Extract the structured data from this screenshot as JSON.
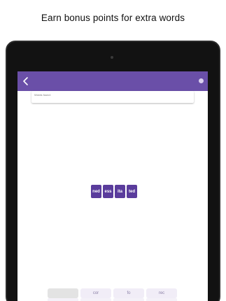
{
  "caption": "Earn bonus points for extra words",
  "colors": {
    "app_bar": "#6a4fa8",
    "tile": "#5a3c9c",
    "option": "#f1edf7",
    "option_used": "#e3e3e3"
  },
  "header": {
    "back_icon": "arrow-left-icon",
    "help_icon": "question-icon"
  },
  "words_found": {
    "label": "Words found:"
  },
  "tiles": [
    "ned",
    "ess",
    "ita",
    "ted"
  ],
  "options": [
    "",
    "cor",
    "fo",
    "rec"
  ]
}
